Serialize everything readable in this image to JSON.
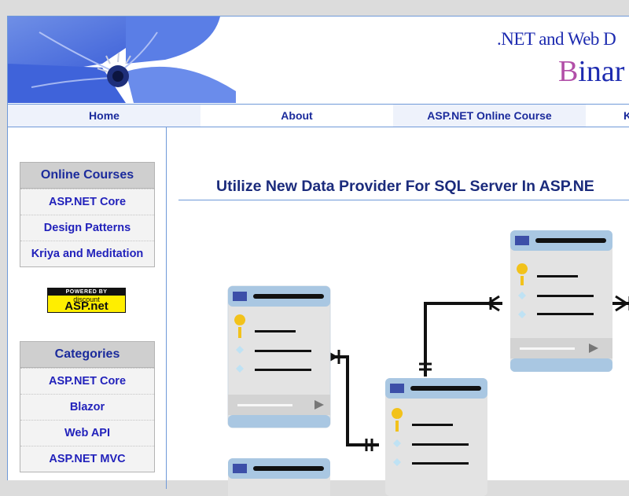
{
  "header": {
    "subtitle": ".NET and Web D",
    "brand_first": "B",
    "brand_rest": "inar"
  },
  "nav": [
    {
      "label": "Home"
    },
    {
      "label": "About"
    },
    {
      "label": "ASP.NET Online Course"
    },
    {
      "label": "K"
    }
  ],
  "sidebar": {
    "online_courses": {
      "title": "Online Courses",
      "links": [
        "ASP.NET Core",
        "Design Patterns",
        "Kriya and Meditation"
      ]
    },
    "badge": {
      "top": "POWERED BY",
      "small": "discount",
      "main": "ASP.net"
    },
    "categories": {
      "title": "Categories",
      "links": [
        "ASP.NET Core",
        "Blazor",
        "Web API",
        "ASP.NET MVC"
      ]
    }
  },
  "article": {
    "title": "Utilize New Data Provider For SQL Server In ASP.NE"
  },
  "colors": {
    "nav_text": "#1b2b9c",
    "link_text": "#2222bb",
    "border_blue": "#6f99d8",
    "brand_purple": "#b24fa8",
    "table_header_blue": "#a9c7e2",
    "key_yellow": "#f2c21b"
  }
}
